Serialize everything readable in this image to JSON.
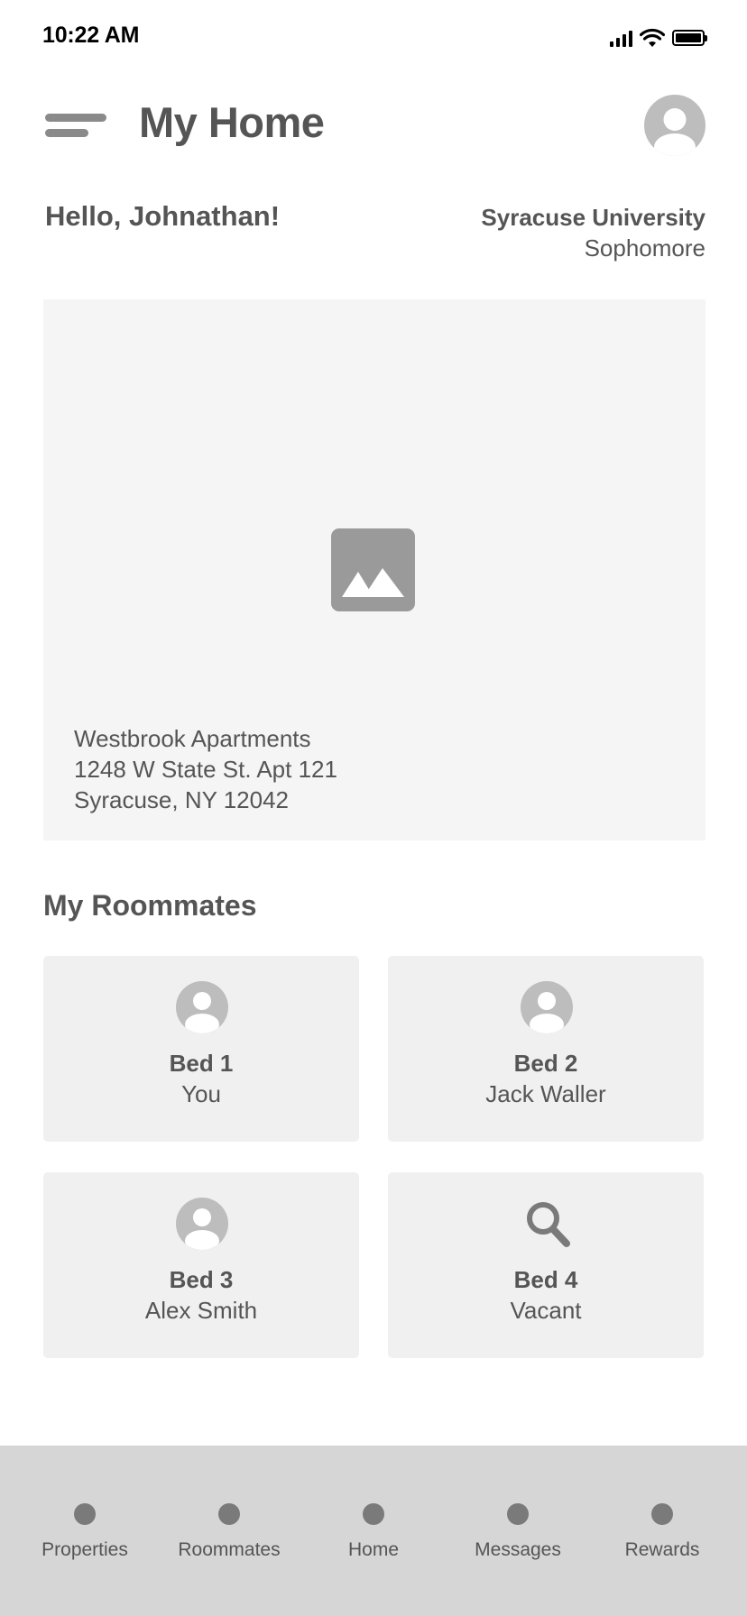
{
  "status_bar": {
    "time": "10:22 AM"
  },
  "header": {
    "title": "My Home"
  },
  "greeting": "Hello, Johnathan!",
  "profile": {
    "university": "Syracuse University",
    "year": "Sophomore"
  },
  "property": {
    "name": "Westbrook Apartments",
    "street": "1248 W State St. Apt 121",
    "city": "Syracuse, NY 12042"
  },
  "roommates": {
    "title": "My Roommates",
    "beds": [
      {
        "label": "Bed 1",
        "name": "You",
        "icon": "person-icon"
      },
      {
        "label": "Bed 2",
        "name": "Jack Waller",
        "icon": "person-icon"
      },
      {
        "label": "Bed 3",
        "name": "Alex Smith",
        "icon": "person-icon"
      },
      {
        "label": "Bed 4",
        "name": "Vacant",
        "icon": "search-icon"
      }
    ]
  },
  "bottom_nav": {
    "items": [
      {
        "label": "Properties"
      },
      {
        "label": "Roommates"
      },
      {
        "label": "Home"
      },
      {
        "label": "Messages"
      },
      {
        "label": "Rewards"
      }
    ]
  },
  "colors": {
    "text": "#555555",
    "card_bg": "#f5f5f5",
    "bed_card_bg": "#f0f0f0",
    "nav_bg": "#d6d6d6",
    "icon_gray": "#bdbdbd"
  }
}
